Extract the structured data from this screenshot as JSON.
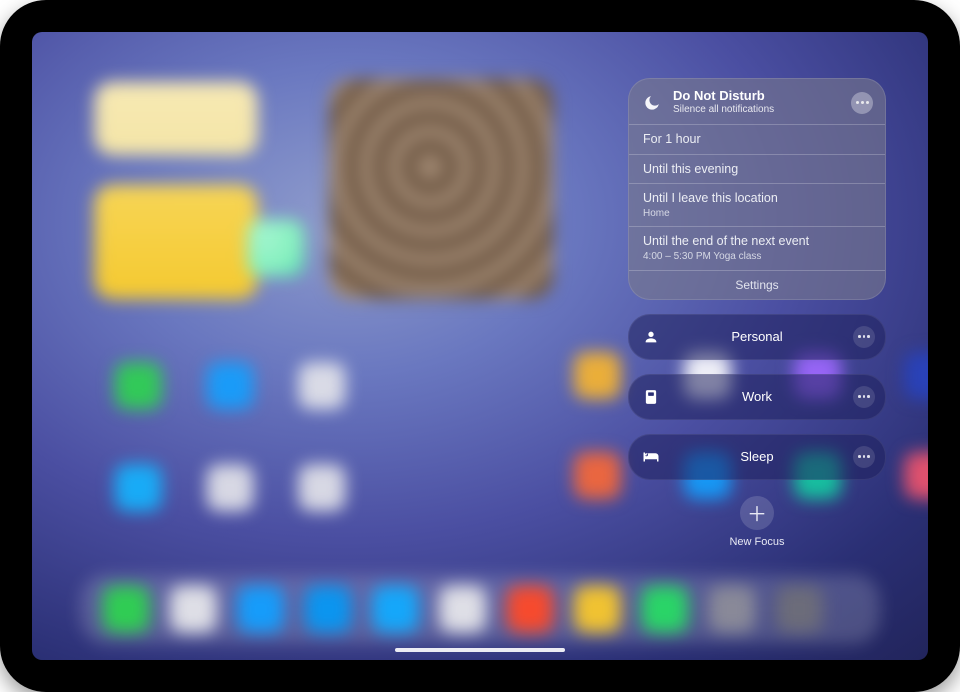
{
  "dnd": {
    "title": "Do Not Disturb",
    "subtitle": "Silence all notifications",
    "options": [
      {
        "label": "For 1 hour"
      },
      {
        "label": "Until this evening"
      },
      {
        "label": "Until I leave this location",
        "sub": "Home"
      },
      {
        "label": "Until the end of the next event",
        "sub": "4:00 – 5:30 PM Yoga class"
      }
    ],
    "settings": "Settings"
  },
  "focus_modes": [
    {
      "icon": "person",
      "label": "Personal"
    },
    {
      "icon": "badge",
      "label": "Work"
    },
    {
      "icon": "bed",
      "label": "Sleep"
    }
  ],
  "new_focus": {
    "label": "New Focus"
  },
  "dock_colors": [
    "#39cf57",
    "#e6e6ea",
    "#1d9df4",
    "#1296e9",
    "#1ea9ff",
    "#e6e6ea",
    "#ff4d2e",
    "#f4c83a",
    "#34d76b",
    "#8c8c98",
    "#6e6e78"
  ]
}
